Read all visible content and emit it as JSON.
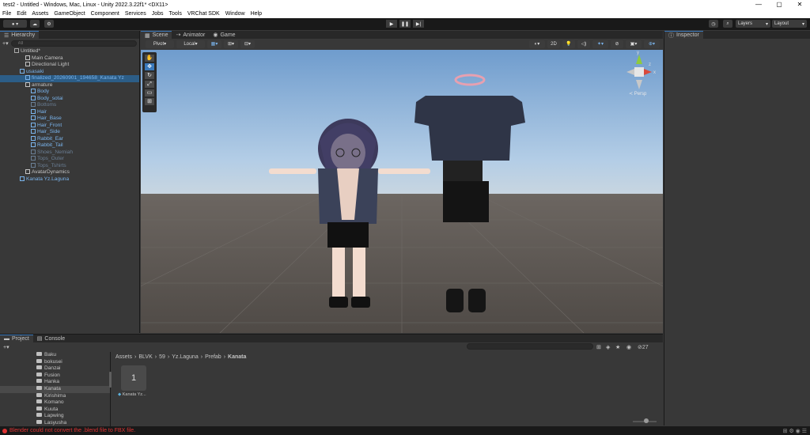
{
  "window": {
    "title": "test2 - Untitled - Windows, Mac, Linux - Unity 2022.3.22f1* <DX11>",
    "min": "—",
    "max": "▢",
    "close": "✕"
  },
  "menu": [
    "File",
    "Edit",
    "Assets",
    "GameObject",
    "Component",
    "Services",
    "Jobs",
    "Tools",
    "VRChat SDK",
    "Window",
    "Help"
  ],
  "toolbar": {
    "layers": "Layers",
    "layout": "Layout"
  },
  "hierarchy": {
    "tab": "Hierarchy",
    "search_placeholder": "All",
    "rows": [
      {
        "label": "Untitled*",
        "indent": 0,
        "style": "scene"
      },
      {
        "label": "Main Camera",
        "indent": 2,
        "style": "normal"
      },
      {
        "label": "Directional Light",
        "indent": 2,
        "style": "normal"
      },
      {
        "label": "usasaki",
        "indent": 1,
        "style": "blue"
      },
      {
        "label": "finalized_20260901_194658_Kanata Yz",
        "indent": 2,
        "style": "blue"
      },
      {
        "label": "armature",
        "indent": 2,
        "style": "normal"
      },
      {
        "label": "Body",
        "indent": 3,
        "style": "blue"
      },
      {
        "label": "Body_sotai",
        "indent": 3,
        "style": "blue"
      },
      {
        "label": "Bottoms",
        "indent": 3,
        "style": "grey"
      },
      {
        "label": "Hair",
        "indent": 3,
        "style": "blue"
      },
      {
        "label": "Hair_Base",
        "indent": 3,
        "style": "blue"
      },
      {
        "label": "Hair_Front",
        "indent": 3,
        "style": "blue"
      },
      {
        "label": "Hair_Side",
        "indent": 3,
        "style": "blue"
      },
      {
        "label": "Rabbit_Ear",
        "indent": 3,
        "style": "blue"
      },
      {
        "label": "Rabbit_Tail",
        "indent": 3,
        "style": "blue"
      },
      {
        "label": "Shoes_Nemiah",
        "indent": 3,
        "style": "grey"
      },
      {
        "label": "Tops_Outer",
        "indent": 3,
        "style": "grey"
      },
      {
        "label": "Tops_Tshirts",
        "indent": 3,
        "style": "grey"
      },
      {
        "label": "AvatarDynamics",
        "indent": 2,
        "style": "normal"
      },
      {
        "label": "Kanata Yz.Laguna",
        "indent": 1,
        "style": "blue"
      }
    ]
  },
  "scene": {
    "tabs": [
      "Scene",
      "Animator",
      "Game"
    ],
    "pivot": "Pivot",
    "local": "Local",
    "mode2d": "2D",
    "gizmo_label": "≺ Persp",
    "gizmo_axes": {
      "x": "x",
      "y": "y",
      "z": "z"
    }
  },
  "project": {
    "tabs": [
      "Project",
      "Console"
    ],
    "folders": [
      "Baku",
      "bokusei",
      "Danzai",
      "Fusion",
      "Hanka",
      "Kanata",
      "Kirishima",
      "Komano",
      "Kuuta",
      "Lapwing",
      "Lasyusha"
    ],
    "breadcrumb": [
      "Assets",
      "BLVK",
      "59",
      "Yz.Laguna",
      "Prefab",
      "Kanata"
    ],
    "asset": {
      "label": "Kanata Yz...",
      "thumb_glyph": "1"
    },
    "count": "27"
  },
  "inspector": {
    "tab": "Inspector"
  },
  "status": {
    "message": "Blender could not convert the .blend file to FBX file."
  },
  "colors": {
    "accent": "#3a79bb",
    "blueText": "#7ab4ec",
    "error": "#d33030",
    "sky": "#a6c4e4",
    "ground": "#5c5651"
  }
}
